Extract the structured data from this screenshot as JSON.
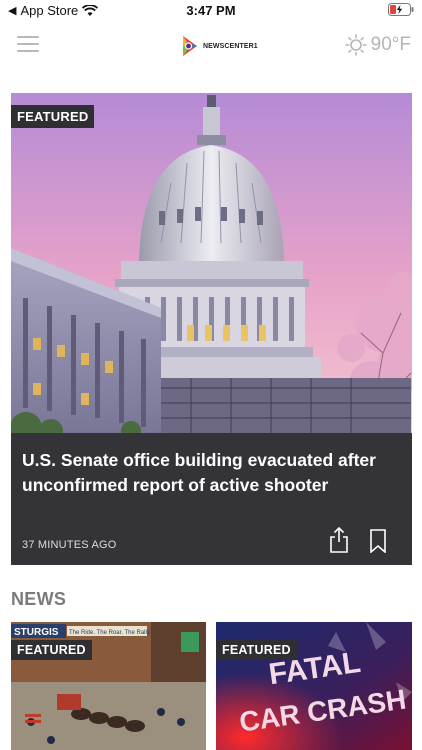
{
  "status_bar": {
    "back_app": "App Store",
    "time": "3:47 PM"
  },
  "header": {
    "logo_text": "NEWSCENTER1",
    "temperature": "90°F",
    "weather_icon": "sun-icon",
    "menu_icon": "hamburger-menu-icon"
  },
  "hero": {
    "badge": "FEATURED",
    "title": "U.S. Senate office building evacuated after unconfirmed report of active shooter",
    "time_ago": "37 MINUTES AGO",
    "share_icon": "share-icon",
    "bookmark_icon": "bookmark-icon"
  },
  "news": {
    "section_title": "NEWS",
    "cards": [
      {
        "badge": "FEATURED",
        "banner_text": "STURGIS",
        "banner_tagline": "The Ride. The Roar. The Rally."
      },
      {
        "badge": "FEATURED",
        "graphic_line_1": "FATAL",
        "graphic_line_2": "CAR CRASH"
      }
    ]
  },
  "colors": {
    "badge_bg": "#2f2f33",
    "hero_panel": "#333338",
    "muted_gray": "#b5b5b5",
    "battery_charging": "#e0453a"
  }
}
